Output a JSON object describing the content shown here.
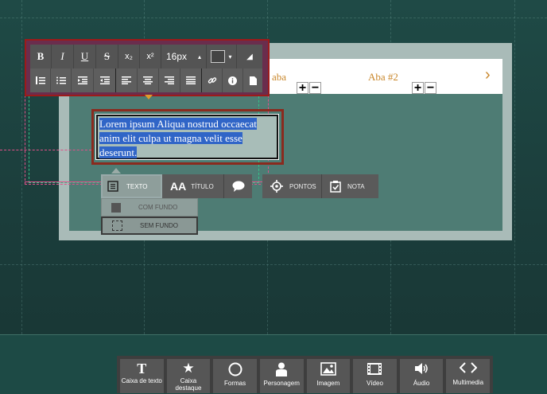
{
  "tabs": {
    "tab1_label": "aba",
    "tab2_label": "Aba #2",
    "plus": "+",
    "minus": "−",
    "next_glyph": "›"
  },
  "format_toolbar": {
    "bold": "B",
    "italic": "I",
    "underline": "U",
    "strike": "S",
    "subscript": "x₂",
    "superscript": "x²",
    "font_size": "16px",
    "size_arrow": "▴",
    "color_arrow": "▾",
    "eraser": "◢"
  },
  "text_box": {
    "line1": "Lorem ipsum Aliqua nostrud occaecat",
    "line2": "anim elit culpa ut magna velit esse",
    "line3": "deserunt."
  },
  "type_bar": {
    "texto": "TEXTO",
    "titulo": "TÍTULO",
    "pontos": "PONTOS",
    "nota": "NOTA",
    "com_fundo": "COM FUNDO",
    "sem_fundo": "SEM FUNDO"
  },
  "bottom_toolbar": {
    "items": [
      {
        "label": "Caixa de texto",
        "glyph": "T"
      },
      {
        "label": "Caixa destaque",
        "glyph": "★"
      },
      {
        "label": "Formas",
        "glyph": "◯"
      },
      {
        "label": "Personagem",
        "glyph": "♟"
      },
      {
        "label": "Imagem",
        "glyph": "▣"
      },
      {
        "label": "Vídeo",
        "glyph": "▤"
      },
      {
        "label": "Áudio",
        "glyph": "◀)"
      },
      {
        "label": "Multimedia",
        "glyph": "<>"
      }
    ]
  },
  "colors": {
    "background": "#1f4a46",
    "accent_tab": "#c9872b",
    "selection_red": "#9d1a1a",
    "highlight_blue": "#3065c7"
  }
}
